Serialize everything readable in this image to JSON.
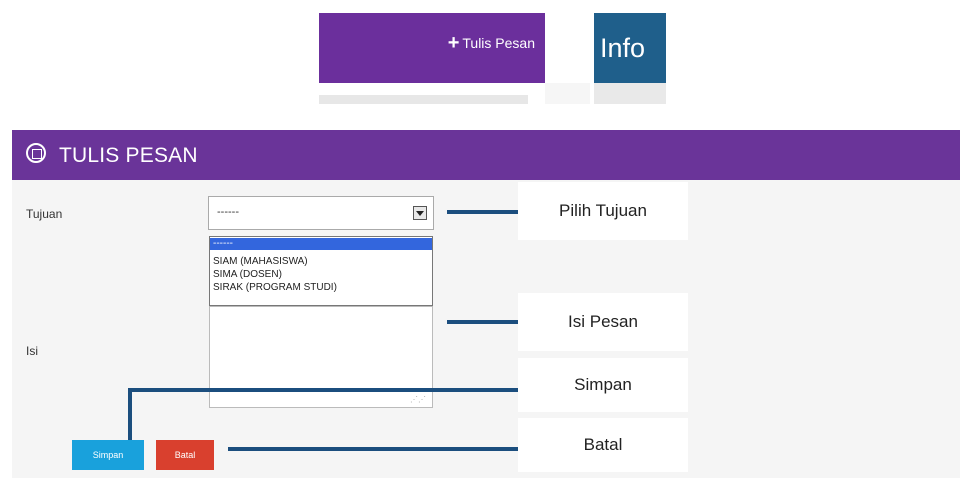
{
  "top_tabs": {
    "write_label": "Tulis Pesan",
    "info_label": "Info"
  },
  "panel": {
    "title": "TULIS PESAN"
  },
  "form": {
    "tujuan_label": "Tujuan",
    "isi_label": "Isi",
    "select_value": "------",
    "options": [
      "------",
      "SIAM (MAHASISWA)",
      "SIMA (DOSEN)",
      "SIRAK (PROGRAM STUDI)"
    ],
    "save_label": "Simpan",
    "cancel_label": "Batal"
  },
  "callouts": {
    "pilih_tujuan": "Pilih Tujuan",
    "isi_pesan": "Isi Pesan",
    "simpan": "Simpan",
    "batal": "Batal"
  }
}
